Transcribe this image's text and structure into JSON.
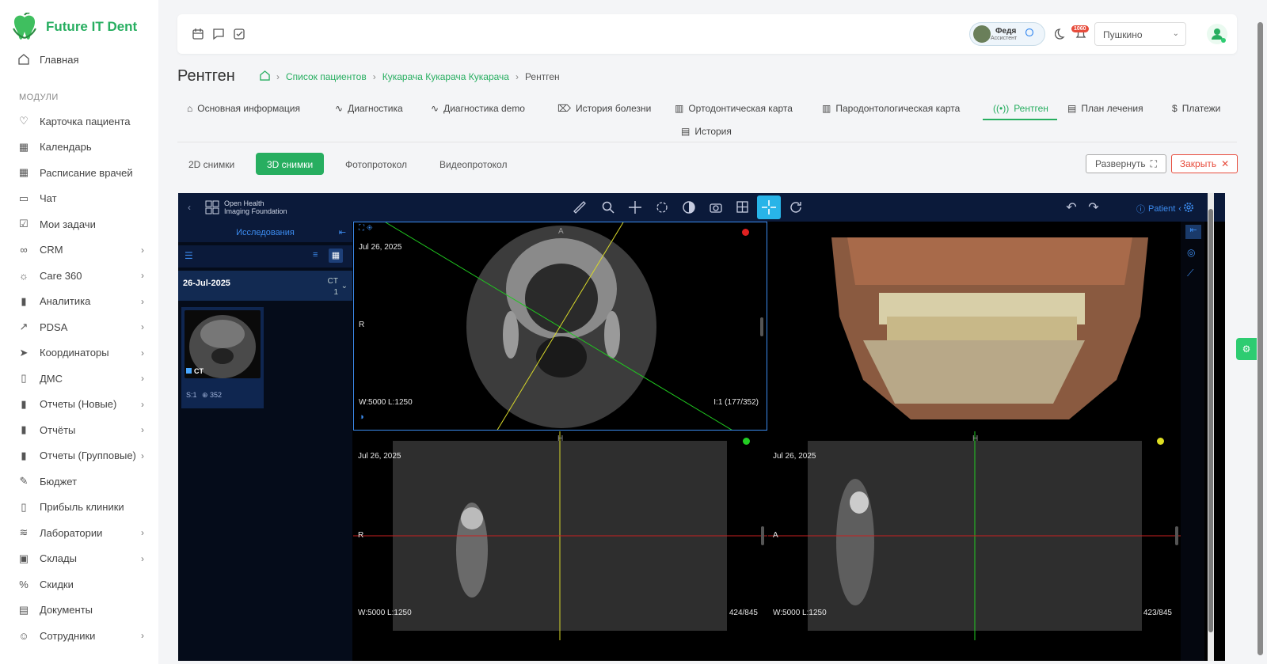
{
  "app": {
    "name": "Future IT Dent"
  },
  "sidebar": {
    "home": "Главная",
    "section": "МОДУЛИ",
    "items": [
      {
        "label": "Карточка пациента",
        "icon": "heart-icon",
        "chevron": false
      },
      {
        "label": "Календарь",
        "icon": "calendar-icon",
        "chevron": false
      },
      {
        "label": "Расписание врачей",
        "icon": "calendar-icon",
        "chevron": false
      },
      {
        "label": "Чат",
        "icon": "chat-icon",
        "chevron": false
      },
      {
        "label": "Мои задачи",
        "icon": "checkbox-icon",
        "chevron": false
      },
      {
        "label": "CRM",
        "icon": "infinity-icon",
        "chevron": true
      },
      {
        "label": "Care 360",
        "icon": "sun-icon",
        "chevron": true
      },
      {
        "label": "Аналитика",
        "icon": "bar-chart-icon",
        "chevron": true
      },
      {
        "label": "PDSA",
        "icon": "trend-icon",
        "chevron": true
      },
      {
        "label": "Координаторы",
        "icon": "send-icon",
        "chevron": true
      },
      {
        "label": "ДМС",
        "icon": "clipboard-icon",
        "chevron": true
      },
      {
        "label": "Отчеты (Новые)",
        "icon": "bar-chart-icon",
        "chevron": true
      },
      {
        "label": "Отчёты",
        "icon": "bar-chart-icon",
        "chevron": true
      },
      {
        "label": "Отчеты (Групповые)",
        "icon": "bar-chart-icon",
        "chevron": true
      },
      {
        "label": "Бюджет",
        "icon": "feather-icon",
        "chevron": false
      },
      {
        "label": "Прибыль клиники",
        "icon": "clipboard-icon",
        "chevron": false
      },
      {
        "label": "Лаборатории",
        "icon": "layers-icon",
        "chevron": true
      },
      {
        "label": "Склады",
        "icon": "folder-icon",
        "chevron": true
      },
      {
        "label": "Скидки",
        "icon": "percent-icon",
        "chevron": false
      },
      {
        "label": "Документы",
        "icon": "document-icon",
        "chevron": false
      },
      {
        "label": "Сотрудники",
        "icon": "users-icon",
        "chevron": true
      }
    ]
  },
  "topbar": {
    "user_name": "Федя",
    "user_role": "Ассистент",
    "notifications": "1060",
    "location": "Пушкино"
  },
  "page": {
    "title": "Рентген",
    "breadcrumb": [
      "Список пациентов",
      "Кукарача Кукарача Кукарача",
      "Рентген"
    ]
  },
  "tabs": [
    "Основная информация",
    "Диагностика",
    "Диагностика demo",
    "История болезни",
    "Ортодонтическая карта",
    "Пародонтологическая карта",
    "Рентген",
    "План лечения",
    "Платежи",
    "История"
  ],
  "subtabs": [
    "2D снимки",
    "3D снимки",
    "Фотопротокол",
    "Видеопротокол"
  ],
  "buttons": {
    "expand": "Развернуть",
    "close": "Закрыть"
  },
  "viewer": {
    "logo_line1": "Open Health",
    "logo_line2": "Imaging Foundation",
    "patient": "Patient",
    "studies_header": "Исследования",
    "study_date": "26-Jul-2025",
    "study_modality": "CT",
    "study_count": "1",
    "thumb_label": "CT",
    "thumb_series": "S:1",
    "thumb_images": "352",
    "panes": {
      "axial": {
        "date": "Jul 26, 2025",
        "orient": "R",
        "wl": "W:5000  L:1250",
        "index": "I:1 (177/352)",
        "top": "A",
        "dot": "#e02020"
      },
      "coronal": {
        "date": "Jul 26, 2025",
        "orient": "R",
        "wl": "W:5000  L:1250",
        "index": "424/845",
        "top": "H",
        "dot": "#22cc22"
      },
      "sagittal": {
        "date": "Jul 26, 2025",
        "orient": "A",
        "wl": "W:5000  L:1250",
        "index": "423/845",
        "top": "H",
        "dot": "#dddd22"
      }
    }
  },
  "colors": {
    "accent": "#27ae60",
    "viewer_bg": "#0b1a3a",
    "viewer_accent": "#28b4e8",
    "danger": "#e74c3c"
  }
}
